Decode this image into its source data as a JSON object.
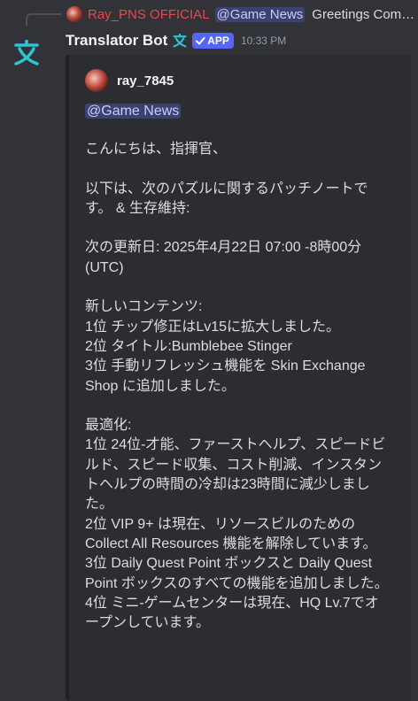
{
  "reply": {
    "author": "Ray_PNS OFFICIAL",
    "mention": "@Game News",
    "text": "Greetings Commander,"
  },
  "message": {
    "author": "Translator Bot",
    "tag": "APP",
    "timestamp": "10:33 PM"
  },
  "embed": {
    "author": "ray_7845",
    "mention": "@Game News",
    "greeting": "こんにちは、指揮官、",
    "intro": "以下は、次のパズルに関するパッチノートです。 & 生存維持:",
    "next_update": "次の更新日: 2025年4月22日 07:00 -8時00分(UTC)",
    "new_content_heading": "新しいコンテンツ:",
    "new_content": [
      "1位 チップ修正はLv15に拡大しました。",
      "2位 タイトル:Bumblebee Stinger",
      "3位 手動リフレッシュ機能を Skin Exchange Shop に追加しました。"
    ],
    "optimization_heading": "最適化:",
    "optimization": [
      "1位 24位-才能、ファーストヘルプ、スピードビルド、スピード収集、コスト削減、インスタントヘルプの時間の冷却は23時間に減少しました。",
      "2位 VIP 9+ は現在、リソースビルのための Collect All Resources 機能を解除しています。",
      "3位 Daily Quest Point ボックスと Daily Quest Point ボックスのすべての機能を追加しました。",
      "4位 ミニ-ゲームセンターは現在、HQ Lv.7でオープンしています。"
    ]
  },
  "colors": {
    "background": "#313338",
    "embed_bg": "#2b2d31",
    "accent": "#5865f2",
    "bot_icon": "#2dc5d4",
    "reply_author": "#e34b4b"
  }
}
